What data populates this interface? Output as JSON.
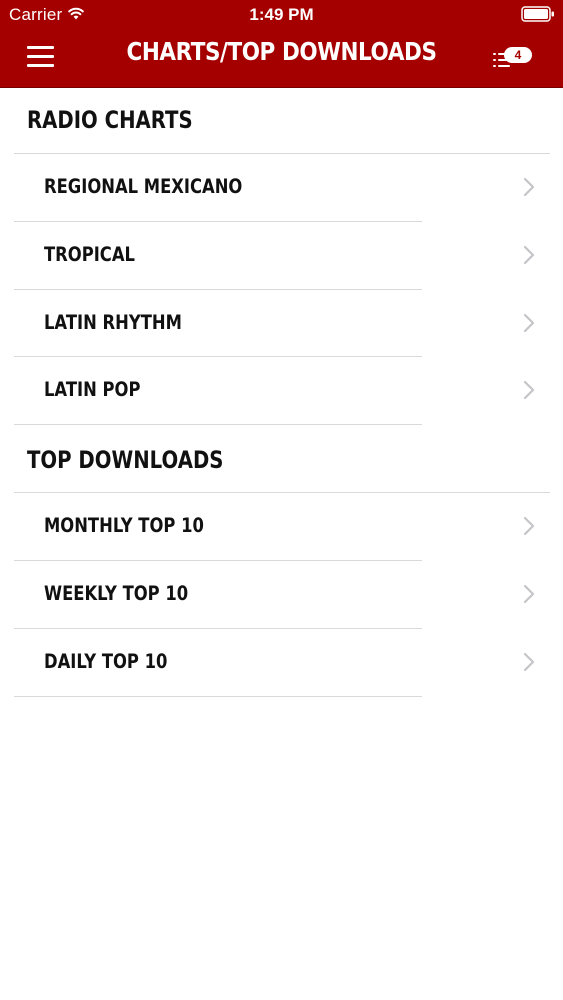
{
  "status_bar": {
    "carrier": "Carrier",
    "time": "1:49 PM"
  },
  "header": {
    "title": "CHARTS/TOP DOWNLOADS",
    "queue_count": "4",
    "menu_icon": "hamburger-menu-icon",
    "queue_icon": "queue-list-icon"
  },
  "sections": [
    {
      "title": "RADIO CHARTS",
      "items": [
        {
          "label": "REGIONAL MEXICANO"
        },
        {
          "label": "TROPICAL"
        },
        {
          "label": "LATIN RHYTHM"
        },
        {
          "label": "LATIN POP"
        }
      ]
    },
    {
      "title": "TOP DOWNLOADS",
      "items": [
        {
          "label": "MONTHLY TOP 10"
        },
        {
          "label": "WEEKLY TOP 10"
        },
        {
          "label": "DAILY TOP 10"
        }
      ]
    }
  ],
  "colors": {
    "header_background": "#a50000",
    "text": "#111111",
    "divider": "#d9d9d9",
    "chevron": "#c4c4c9"
  }
}
